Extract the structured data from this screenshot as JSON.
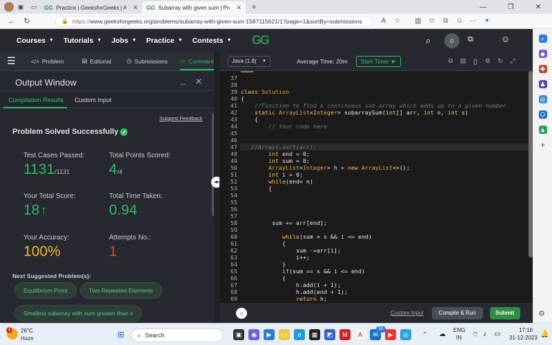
{
  "browser": {
    "tabs": [
      {
        "label": "Practice | GeeksforGeeks | A com",
        "active": false
      },
      {
        "label": "Subarray with given sum | Practic",
        "active": true
      }
    ],
    "new_tab": "+",
    "url_prefix": "https://",
    "url": "www.geeksforgeeks.org/problems/subarray-with-given-sum-1587115621/1?page=1&sortBy=submissions"
  },
  "gfg_nav": {
    "items": [
      "Courses",
      "Tutorials",
      "Jobs",
      "Practice",
      "Contests"
    ],
    "logo": "GG"
  },
  "problem_tabs": [
    {
      "label": "Problem",
      "icon": "code-icon"
    },
    {
      "label": "Editorial",
      "icon": "document-icon"
    },
    {
      "label": "Submissions",
      "icon": "clock-icon"
    },
    {
      "label": "Comments",
      "icon": "comment-icon",
      "active": true
    }
  ],
  "output": {
    "title": "Output Window",
    "tab_results": "Compilation Results",
    "tab_custom": "Custom Input",
    "suggest_feedback": "Suggest Feedback",
    "status": "Problem Solved Successfully",
    "test_cases_label": "Test Cases Passed:",
    "test_cases_value": "1131",
    "test_cases_total": "/1131",
    "points_label": "Total Points Scored:",
    "points_value": "4",
    "points_total": "/4",
    "score_label": "Your Total Score:",
    "score_value": "18",
    "time_label": "Total Time Taken:",
    "time_value": "0.94",
    "accuracy_label": "Your Accuracy:",
    "accuracy_value": "100%",
    "attempts_label": "Attempts No.:",
    "attempts_value": "1",
    "next_label": "Next Suggested Problem(s):",
    "suggestions": [
      "Equilibrium Point",
      "Two Repeated Elements",
      "Smallest subarray with sum greater than x"
    ]
  },
  "editor": {
    "language": "Java (1.8)",
    "avg_time": "Average Time: 20m",
    "start_timer": "Start Timer",
    "custom_input": "Custom Input",
    "compile_run": "Compile & Run",
    "submit": "Submit",
    "lines": [
      {
        "n": "37",
        "code": ""
      },
      {
        "n": "38",
        "code": ""
      },
      {
        "n": "39",
        "code": "class Solution"
      },
      {
        "n": "40",
        "code": "{"
      },
      {
        "n": "41",
        "code": "    //Function to find a continuous sub-array which adds up to a given number."
      },
      {
        "n": "42",
        "code": "    static ArrayList<Integer> subarraySum(int[] arr, int n, int s)"
      },
      {
        "n": "43",
        "code": "    {"
      },
      {
        "n": "44",
        "code": "        // Your code here"
      },
      {
        "n": "45",
        "code": ""
      },
      {
        "n": "46",
        "code": ""
      },
      {
        "n": "47",
        "code": "   //Arrays.sort(arr);"
      },
      {
        "n": "48",
        "code": "        int end = 0;"
      },
      {
        "n": "49",
        "code": "        int sum = 0;"
      },
      {
        "n": "50",
        "code": "        ArrayList<Integer> h = new ArrayList<>();"
      },
      {
        "n": "51",
        "code": "        int i = 0;"
      },
      {
        "n": "52",
        "code": "        while(end< n)"
      },
      {
        "n": "53",
        "code": "        {"
      },
      {
        "n": "54",
        "code": ""
      },
      {
        "n": "55",
        "code": ""
      },
      {
        "n": "56",
        "code": ""
      },
      {
        "n": "57",
        "code": ""
      },
      {
        "n": "58",
        "code": "         sum += arr[end];"
      },
      {
        "n": "59",
        "code": ""
      },
      {
        "n": "60",
        "code": "            while(sum > s && i <= end)"
      },
      {
        "n": "61",
        "code": "            {"
      },
      {
        "n": "62",
        "code": "                sum -=arr[i];"
      },
      {
        "n": "63",
        "code": "                i++;"
      },
      {
        "n": "64",
        "code": "            }"
      },
      {
        "n": "65",
        "code": "            if(sum == s && i <= end)"
      },
      {
        "n": "66",
        "code": "            {"
      },
      {
        "n": "67",
        "code": "                h.add(i + 1);"
      },
      {
        "n": "68",
        "code": "                h.add(end + 1);"
      },
      {
        "n": "69",
        "code": "                return h;"
      }
    ]
  },
  "taskbar": {
    "weather_temp": "26°C",
    "weather_desc": "Haze",
    "search": "Search",
    "lang1": "ENG",
    "lang2": "IN",
    "time": "17:16",
    "date": "31-12-2023",
    "mail_badge": "53",
    "weather_badge": "1"
  }
}
